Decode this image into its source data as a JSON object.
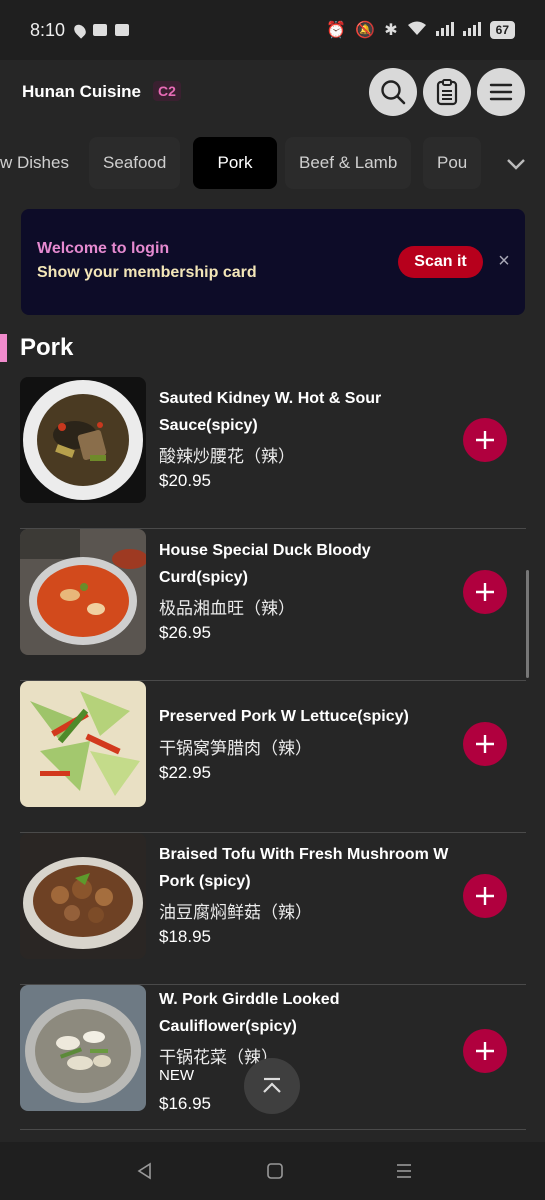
{
  "status_bar": {
    "time": "8:10",
    "battery": "67"
  },
  "header": {
    "title": "Hunan Cuisine",
    "badge": "C2"
  },
  "categories": [
    {
      "label": "w Dishes"
    },
    {
      "label": "Seafood"
    },
    {
      "label": "Pork",
      "active": true
    },
    {
      "label": "Beef & Lamb"
    },
    {
      "label": "Pou"
    }
  ],
  "banner": {
    "line1": "Welcome to login",
    "line2": "Show your membership card",
    "button": "Scan it",
    "close": "×"
  },
  "section": {
    "title": "Pork"
  },
  "items": [
    {
      "name": "Sauted Kidney W. Hot & Sour Sauce(spicy)",
      "name_cn": "酸辣炒腰花（辣）",
      "price": "$20.95"
    },
    {
      "name": "House Special Duck Bloody Curd(spicy)",
      "name_cn": "极品湘血旺（辣）",
      "price": "$26.95"
    },
    {
      "name": "Preserved Pork W Lettuce(spicy)",
      "name_cn": "干锅窝笋腊肉（辣）",
      "price": "$22.95"
    },
    {
      "name": "Braised Tofu With Fresh Mushroom W Pork (spicy)",
      "name_cn": "油豆腐焖鲜菇（辣）",
      "price": "$18.95"
    },
    {
      "name": "W. Pork Girddle Looked Cauliflower(spicy)",
      "name_cn": "干锅花菜（辣）",
      "tag": "NEW",
      "price": "$16.95"
    }
  ],
  "colors": {
    "accent": "#b0003e",
    "banner_bg": "#0d0c28",
    "section_mark": "#f08bcc"
  }
}
